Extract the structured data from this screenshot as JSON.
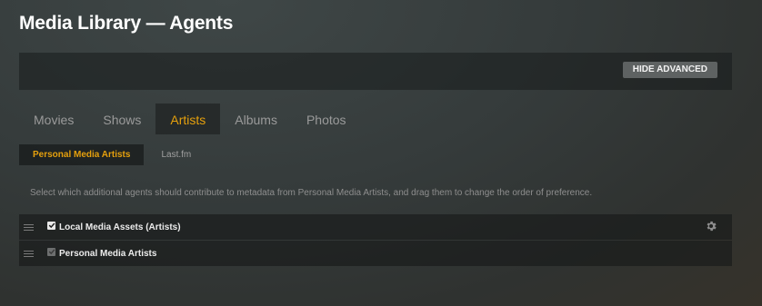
{
  "page": {
    "title": "Media Library — Agents"
  },
  "toolbar": {
    "hide_advanced_label": "HIDE ADVANCED"
  },
  "tabs": [
    {
      "label": "Movies",
      "active": false
    },
    {
      "label": "Shows",
      "active": false
    },
    {
      "label": "Artists",
      "active": true
    },
    {
      "label": "Albums",
      "active": false
    },
    {
      "label": "Photos",
      "active": false
    }
  ],
  "subtabs": [
    {
      "label": "Personal Media Artists",
      "active": true
    },
    {
      "label": "Last.fm",
      "active": false
    }
  ],
  "instructions": "Select which additional agents should contribute to metadata from Personal Media Artists, and drag them to change the order of preference.",
  "agents": [
    {
      "name": "Local Media Assets (Artists)",
      "checked": true,
      "enabled": true,
      "has_settings": true
    },
    {
      "name": "Personal Media Artists",
      "checked": true,
      "enabled": false,
      "has_settings": false
    }
  ],
  "colors": {
    "accent": "#e5a00d",
    "button_bg": "#5e6262"
  },
  "icons": {
    "drag": "drag-handle-icon",
    "check": "checkmark-icon",
    "settings": "gear-icon"
  }
}
